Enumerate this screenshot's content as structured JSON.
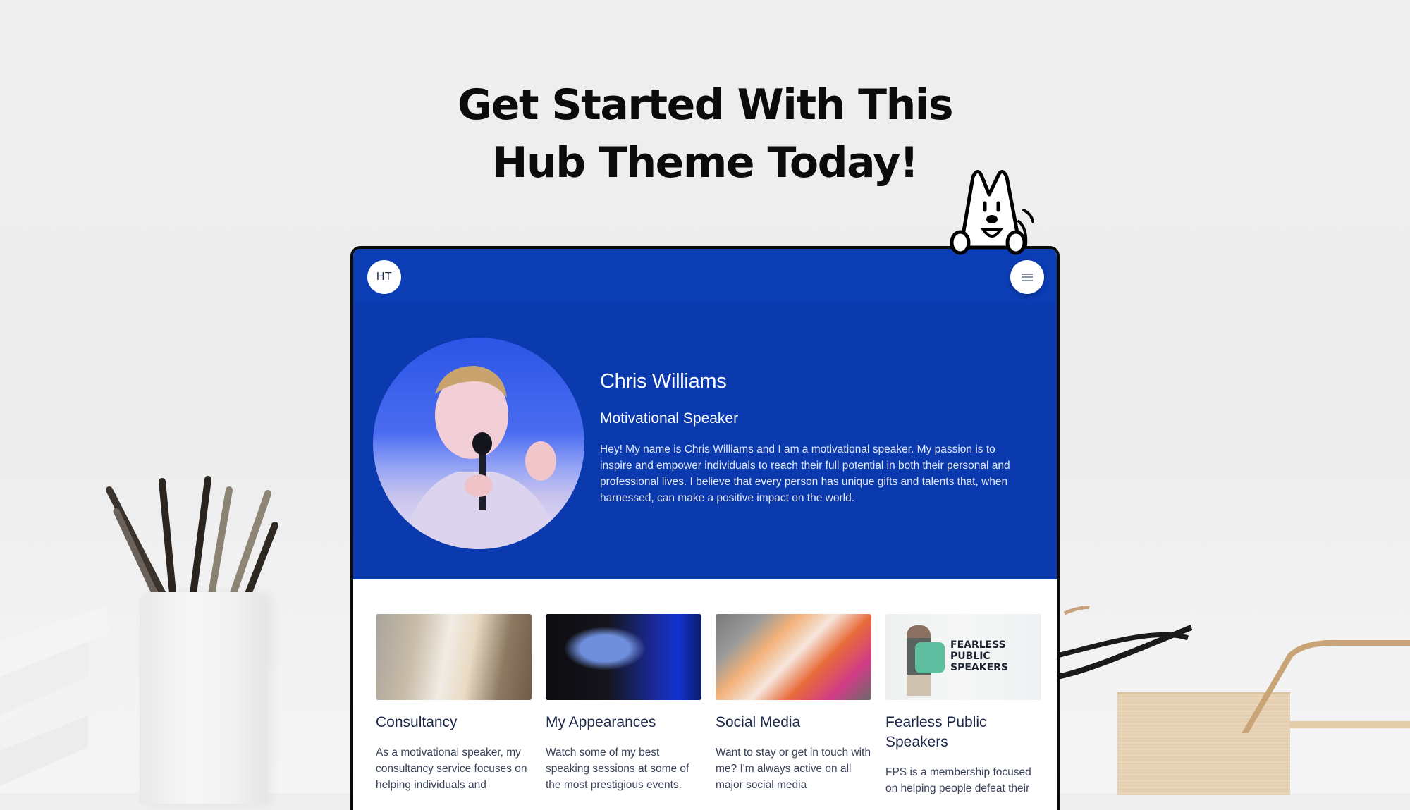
{
  "headline": {
    "line1": "Get Started With This",
    "line2": "Hub Theme Today!"
  },
  "site": {
    "logo_text": "HT",
    "menu_icon": "hamburger-menu-icon",
    "colors": {
      "header": "#0b3db5",
      "hero": "#0a3aae",
      "card_title": "#1c2748",
      "card_text": "#3a4259"
    }
  },
  "hero": {
    "name": "Chris Williams",
    "role": "Motivational Speaker",
    "bio": "Hey! My name is Chris Williams and I am a motivational speaker. My passion is to inspire and empower individuals to reach their full potential in both their personal and professional lives. I believe that every person has unique gifts and talents that, when harnessed, can make a positive impact on the world.",
    "photo_alt": "Chris Williams speaking into a microphone"
  },
  "cards": [
    {
      "title": "Consultancy",
      "description": "As a motivational speaker, my consultancy service focuses on helping individuals and",
      "image_alt": "Man on phone at laptop"
    },
    {
      "title": "My Appearances",
      "description": "Watch some of my best speaking sessions at some of the most prestigious events.",
      "image_alt": "Speaker on stage"
    },
    {
      "title": "Social Media",
      "description": "Want to stay or get in touch with me? I'm always active on all major social media",
      "image_alt": "Phone with social media apps folder"
    },
    {
      "title": "Fearless Public Speakers",
      "description": "FPS is a membership focused on helping people defeat their",
      "image_alt": "Fearless Public Speakers banner",
      "image_text": [
        "FEARLESS",
        "PUBLIC",
        "SPEAKERS"
      ]
    }
  ]
}
